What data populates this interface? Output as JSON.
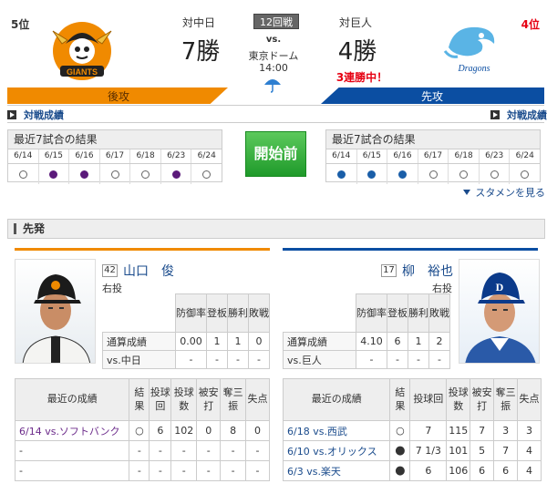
{
  "header": {
    "home": {
      "rank": "5位",
      "vs_label": "対中日",
      "wins": "7勝",
      "bat_order": "後攻",
      "link": "対戦成績"
    },
    "away": {
      "rank": "4位",
      "vs_label": "対巨人",
      "wins": "4勝",
      "bat_order": "先攻",
      "link": "対戦成績",
      "streak": "3連勝中！"
    },
    "game_no": "12回戦",
    "vs": "vs.",
    "stadium": "東京ドーム",
    "time": "14:00"
  },
  "recent7": {
    "title": "最近7試合の結果",
    "home": {
      "dates": [
        "6/14",
        "6/15",
        "6/16",
        "6/17",
        "6/18",
        "6/23",
        "6/24"
      ],
      "results": [
        "empty",
        "purple",
        "purple",
        "empty",
        "empty",
        "purple",
        "empty"
      ]
    },
    "away": {
      "dates": [
        "6/14",
        "6/15",
        "6/16",
        "6/17",
        "6/18",
        "6/23",
        "6/24"
      ],
      "results": [
        "blue",
        "blue",
        "blue",
        "empty",
        "empty",
        "empty",
        "empty"
      ]
    }
  },
  "start_button": "開始前",
  "starting_members_link": "スタメンを見る",
  "section_title": "先発",
  "colors": {
    "giants_orange": "#f08a00",
    "dragons_blue": "#0b4ea2",
    "result_purple": "#5b1a7a",
    "result_blue": "#1a5ea8",
    "start_green": "#2aa636",
    "streak_red": "#e60012"
  },
  "home_pitcher": {
    "number": "42",
    "name": "山口　俊",
    "throws": "右投",
    "stats_headers": [
      "防御率",
      "登板",
      "勝利",
      "敗戦"
    ],
    "rows": [
      {
        "label": "通算成績",
        "values": [
          "0.00",
          "1",
          "1",
          "0"
        ]
      },
      {
        "label": "vs.中日",
        "values": [
          "-",
          "-",
          "-",
          "-"
        ]
      }
    ],
    "recent_headers": [
      "最近の成績",
      "結果",
      "投球回",
      "投球数",
      "被安打",
      "奪三振",
      "失点"
    ],
    "recent": [
      {
        "opp": "6/14 vs.ソフトバンク",
        "result": "○",
        "ip": "6",
        "np": "102",
        "h": "0",
        "so": "8",
        "r": "0"
      },
      {
        "opp": "-",
        "result": "-",
        "ip": "-",
        "np": "-",
        "h": "-",
        "so": "-",
        "r": "-"
      },
      {
        "opp": "-",
        "result": "-",
        "ip": "-",
        "np": "-",
        "h": "-",
        "so": "-",
        "r": "-"
      }
    ]
  },
  "away_pitcher": {
    "number": "17",
    "name": "柳　裕也",
    "throws": "右投",
    "stats_headers": [
      "防御率",
      "登板",
      "勝利",
      "敗戦"
    ],
    "rows": [
      {
        "label": "通算成績",
        "values": [
          "4.10",
          "6",
          "1",
          "2"
        ]
      },
      {
        "label": "vs.巨人",
        "values": [
          "-",
          "-",
          "-",
          "-"
        ]
      }
    ],
    "recent_headers": [
      "最近の成績",
      "結果",
      "投球回",
      "投球数",
      "被安打",
      "奪三振",
      "失点"
    ],
    "recent": [
      {
        "opp": "6/18 vs.西武",
        "result": "○",
        "ip": "7",
        "np": "115",
        "h": "7",
        "so": "3",
        "r": "3"
      },
      {
        "opp": "6/10 vs.オリックス",
        "result": "●",
        "ip": "7 1/3",
        "np": "101",
        "h": "5",
        "so": "7",
        "r": "4"
      },
      {
        "opp": "6/3 vs.楽天",
        "result": "●",
        "ip": "6",
        "np": "106",
        "h": "6",
        "so": "6",
        "r": "4"
      }
    ]
  }
}
